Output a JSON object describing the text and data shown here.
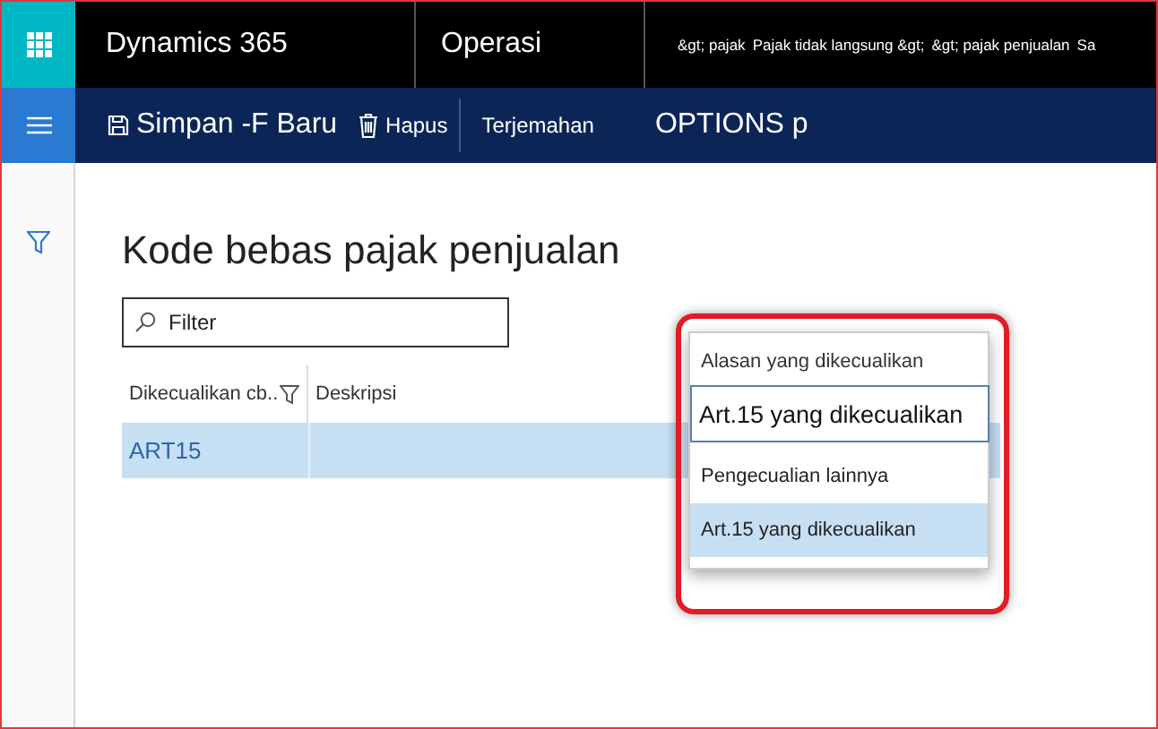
{
  "top_bar": {
    "app_name": "Dynamics 365",
    "module": "Operasi",
    "breadcrumbs": [
      "&gt; pajak",
      "Pajak tidak langsung &gt;",
      "&gt; pajak penjualan",
      "Sa"
    ]
  },
  "action_bar": {
    "actions": [
      {
        "kind": "save",
        "label": "Simpan -F Baru"
      },
      {
        "kind": "delete",
        "label": "Hapus"
      },
      {
        "kind": "plain",
        "label": "Terjemahan"
      },
      {
        "kind": "options",
        "label": "OPTIONS p"
      }
    ]
  },
  "page": {
    "title": "Kode bebas pajak penjualan",
    "filter": {
      "placeholder": "Filter"
    }
  },
  "table": {
    "columns": [
      "Dikecualikan cb..",
      "Deskripsi",
      "Alasan yang dikecualikan"
    ],
    "rows": [
      {
        "code": "ART15",
        "reason": "Art.15 yang dikecualikan",
        "selected": true
      }
    ]
  },
  "dropdown": {
    "options": [
      {
        "label": "Pengecualian lainnya",
        "selected": false
      },
      {
        "label": "Art.15 yang dikecualikan",
        "selected": true
      }
    ]
  }
}
